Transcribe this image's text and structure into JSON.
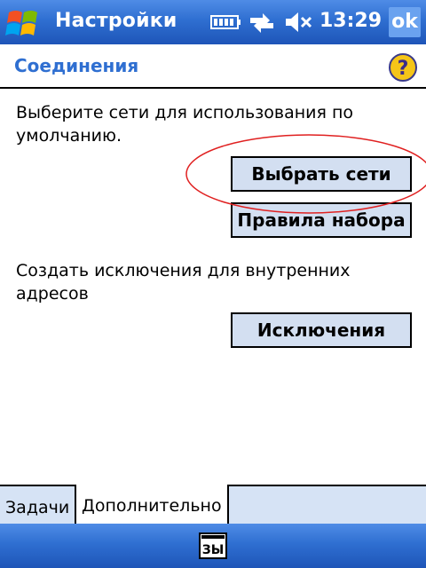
{
  "titlebar": {
    "title": "Настройки",
    "time": "13:29",
    "ok_label": "ok",
    "icons": [
      "windows-start-icon",
      "battery-icon",
      "connectivity-arrows-icon",
      "volume-muted-icon"
    ]
  },
  "section": {
    "title": "Соединения",
    "help_icon": "help-question-icon"
  },
  "content": {
    "text1": "Выберите сети для использования по умолчанию.",
    "select_networks_button": "Выбрать сети",
    "dialing_rules_button": "Правила набора",
    "text2": "Создать исключения для внутренних адресов",
    "exceptions_button": "Исключения",
    "annotation_color": "#e02020"
  },
  "tabs": [
    {
      "label": "Задачи",
      "active": false
    },
    {
      "label": "Дополнительно",
      "active": true
    }
  ],
  "bottombar": {
    "input_icon": "keyboard-input-icon",
    "input_label": "ЗЫ"
  },
  "colors": {
    "titlebar": "#2f6fd1",
    "section_title": "#2f6fd1",
    "button_bg": "#d3dff1",
    "tab_bg": "#d6e3f5"
  }
}
